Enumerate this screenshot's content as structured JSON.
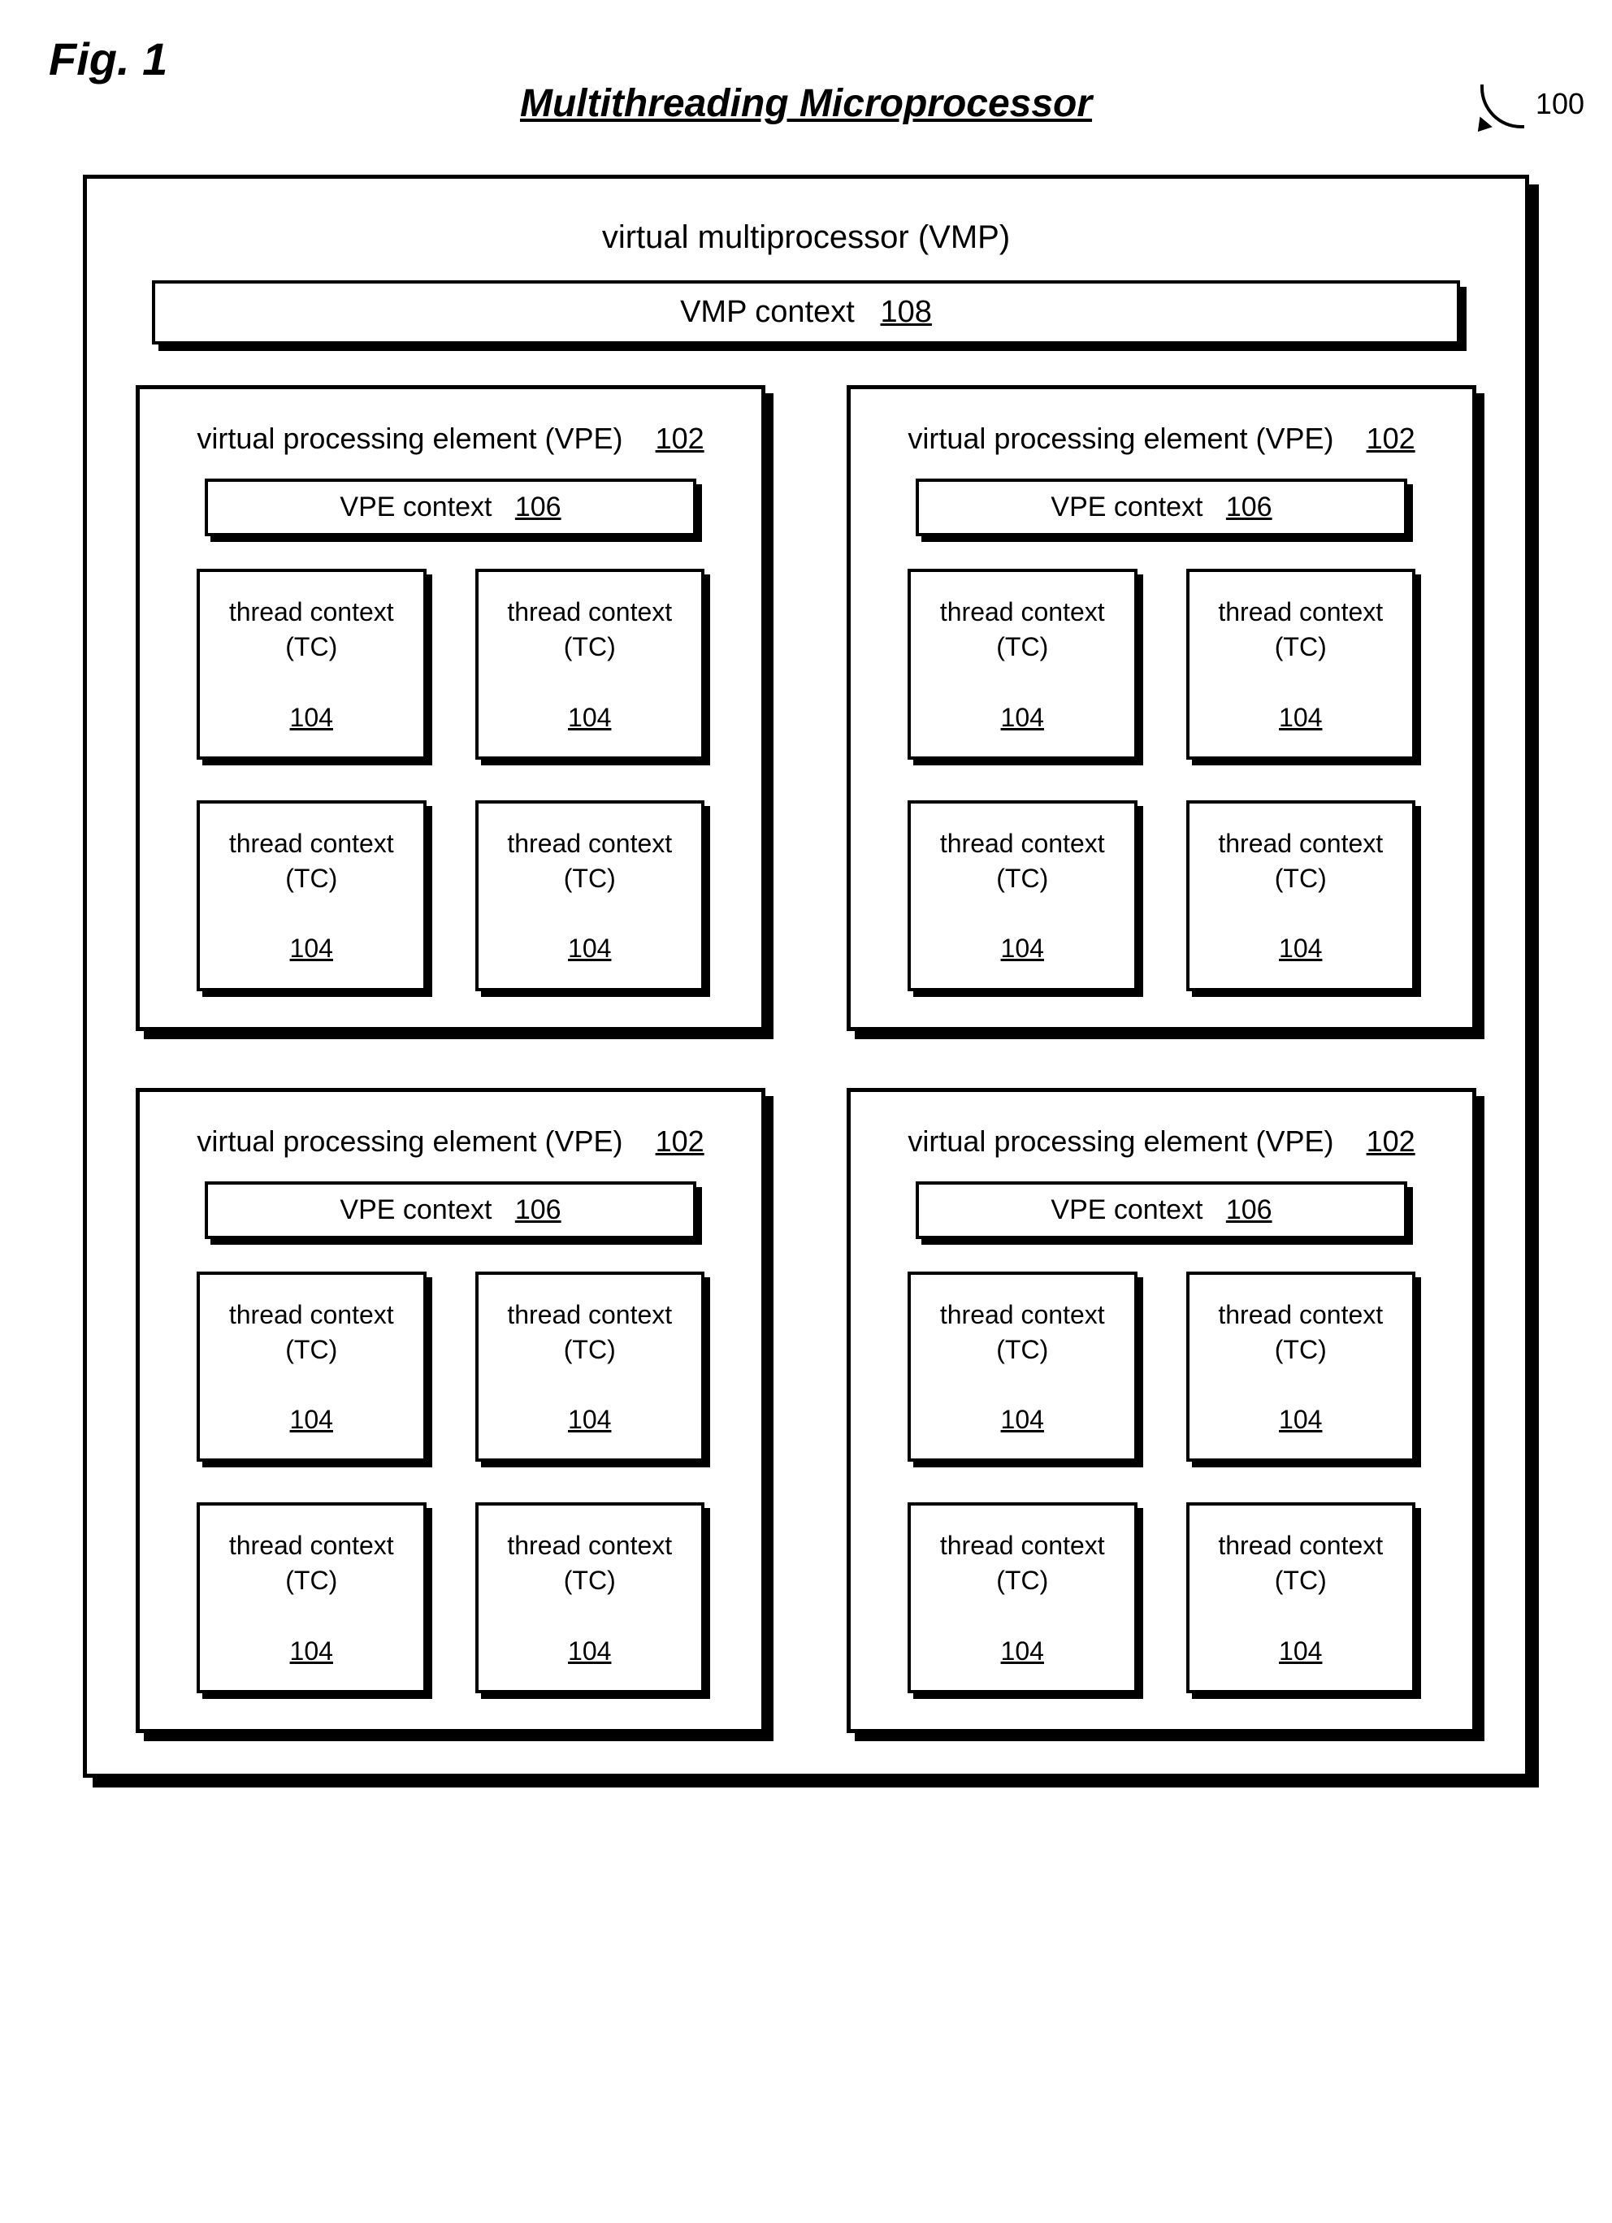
{
  "figure_label": "Fig. 1",
  "title": "Multithreading Microprocessor",
  "ref_num": "100",
  "vmp": {
    "title": "virtual multiprocessor (VMP)",
    "context_label": "VMP context",
    "context_ref": "108",
    "vpes": [
      {
        "title_label": "virtual processing element (VPE)",
        "title_ref": "102",
        "context_label": "VPE context",
        "context_ref": "106",
        "tcs": [
          {
            "label": "thread context (TC)",
            "ref": "104"
          },
          {
            "label": "thread context (TC)",
            "ref": "104"
          },
          {
            "label": "thread context (TC)",
            "ref": "104"
          },
          {
            "label": "thread context (TC)",
            "ref": "104"
          }
        ]
      },
      {
        "title_label": "virtual processing element (VPE)",
        "title_ref": "102",
        "context_label": "VPE context",
        "context_ref": "106",
        "tcs": [
          {
            "label": "thread context (TC)",
            "ref": "104"
          },
          {
            "label": "thread context (TC)",
            "ref": "104"
          },
          {
            "label": "thread context (TC)",
            "ref": "104"
          },
          {
            "label": "thread context (TC)",
            "ref": "104"
          }
        ]
      },
      {
        "title_label": "virtual processing element (VPE)",
        "title_ref": "102",
        "context_label": "VPE context",
        "context_ref": "106",
        "tcs": [
          {
            "label": "thread context (TC)",
            "ref": "104"
          },
          {
            "label": "thread context (TC)",
            "ref": "104"
          },
          {
            "label": "thread context (TC)",
            "ref": "104"
          },
          {
            "label": "thread context (TC)",
            "ref": "104"
          }
        ]
      },
      {
        "title_label": "virtual processing element (VPE)",
        "title_ref": "102",
        "context_label": "VPE context",
        "context_ref": "106",
        "tcs": [
          {
            "label": "thread context (TC)",
            "ref": "104"
          },
          {
            "label": "thread context (TC)",
            "ref": "104"
          },
          {
            "label": "thread context (TC)",
            "ref": "104"
          },
          {
            "label": "thread context (TC)",
            "ref": "104"
          }
        ]
      }
    ]
  }
}
